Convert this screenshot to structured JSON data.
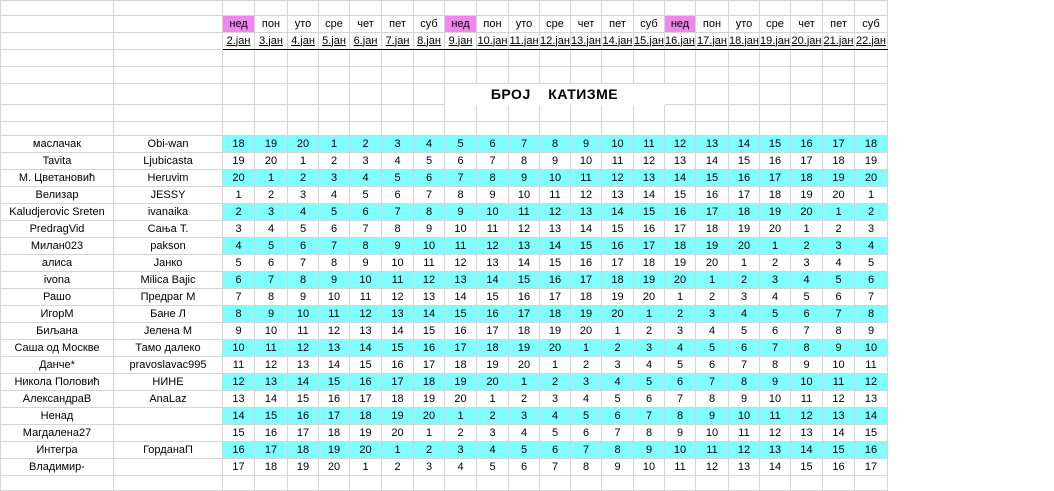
{
  "header": {
    "days": [
      "нед",
      "пон",
      "уто",
      "сре",
      "чет",
      "пет",
      "суб",
      "нед",
      "пон",
      "уто",
      "сре",
      "чет",
      "пет",
      "суб",
      "нед",
      "пон",
      "уто",
      "сре",
      "чет",
      "пет",
      "суб"
    ],
    "dates": [
      "2.јан",
      "3.јан",
      "4.јан",
      "5.јан",
      "6.јан",
      "7.јан",
      "8.јан",
      "9.јан",
      "10.јан",
      "11.јан",
      "12.јан",
      "13.јан",
      "14.јан",
      "15.јан",
      "16.јан",
      "17.јан",
      "18.јан",
      "19.јан",
      "20.јан",
      "21.јан",
      "22.јан"
    ],
    "sunday_color": "#ee88ee"
  },
  "title": "БРОЈ    КАТИЗМЕ",
  "highlight_color": "#7fffff",
  "rows": [
    {
      "name": "маслачак",
      "nick": "Obi-wan",
      "cyan": true,
      "vals": [
        18,
        19,
        20,
        1,
        2,
        3,
        4,
        5,
        6,
        7,
        8,
        9,
        10,
        11,
        12,
        13,
        14,
        15,
        16,
        17,
        18
      ]
    },
    {
      "name": "Tavita",
      "nick": "Ljubicasta",
      "cyan": false,
      "vals": [
        19,
        20,
        1,
        2,
        3,
        4,
        5,
        6,
        7,
        8,
        9,
        10,
        11,
        12,
        13,
        14,
        15,
        16,
        17,
        18,
        19
      ]
    },
    {
      "name": "М. Цветановић",
      "nick": "Heruvim",
      "cyan": true,
      "vals": [
        20,
        1,
        2,
        3,
        4,
        5,
        6,
        7,
        8,
        9,
        10,
        11,
        12,
        13,
        14,
        15,
        16,
        17,
        18,
        19,
        20
      ]
    },
    {
      "name": "Велизар",
      "nick": "JESSY",
      "cyan": false,
      "vals": [
        1,
        2,
        3,
        4,
        5,
        6,
        7,
        8,
        9,
        10,
        11,
        12,
        13,
        14,
        15,
        16,
        17,
        18,
        19,
        20,
        1
      ]
    },
    {
      "name": "Kaludjerovic Sreten",
      "nick": "ivanaika",
      "cyan": true,
      "vals": [
        2,
        3,
        4,
        5,
        6,
        7,
        8,
        9,
        10,
        11,
        12,
        13,
        14,
        15,
        16,
        17,
        18,
        19,
        20,
        1,
        2
      ]
    },
    {
      "name": "PredragVid",
      "nick": "Сања Т.",
      "cyan": false,
      "vals": [
        3,
        4,
        5,
        6,
        7,
        8,
        9,
        10,
        11,
        12,
        13,
        14,
        15,
        16,
        17,
        18,
        19,
        20,
        1,
        2,
        3
      ]
    },
    {
      "name": "Милан023",
      "nick": "pakson",
      "cyan": true,
      "vals": [
        4,
        5,
        6,
        7,
        8,
        9,
        10,
        11,
        12,
        13,
        14,
        15,
        16,
        17,
        18,
        19,
        20,
        1,
        2,
        3,
        4
      ]
    },
    {
      "name": "алиса",
      "nick": "Јанко",
      "cyan": false,
      "vals": [
        5,
        6,
        7,
        8,
        9,
        10,
        11,
        12,
        13,
        14,
        15,
        16,
        17,
        18,
        19,
        20,
        1,
        2,
        3,
        4,
        5
      ]
    },
    {
      "name": "ivona",
      "nick": "Milica Bajic",
      "cyan": true,
      "vals": [
        6,
        7,
        8,
        9,
        10,
        11,
        12,
        13,
        14,
        15,
        16,
        17,
        18,
        19,
        20,
        1,
        2,
        3,
        4,
        5,
        6
      ]
    },
    {
      "name": "Рашо",
      "nick": "Предраг М",
      "cyan": false,
      "vals": [
        7,
        8,
        9,
        10,
        11,
        12,
        13,
        14,
        15,
        16,
        17,
        18,
        19,
        20,
        1,
        2,
        3,
        4,
        5,
        6,
        7
      ]
    },
    {
      "name": "ИгорМ",
      "nick": "Бане Л",
      "cyan": true,
      "vals": [
        8,
        9,
        10,
        11,
        12,
        13,
        14,
        15,
        16,
        17,
        18,
        19,
        20,
        1,
        2,
        3,
        4,
        5,
        6,
        7,
        8
      ]
    },
    {
      "name": "Биљана",
      "nick": "Јелена М",
      "cyan": false,
      "vals": [
        9,
        10,
        11,
        12,
        13,
        14,
        15,
        16,
        17,
        18,
        19,
        20,
        1,
        2,
        3,
        4,
        5,
        6,
        7,
        8,
        9
      ]
    },
    {
      "name": "Саша од Москве",
      "nick": "Тамо далеко",
      "cyan": true,
      "vals": [
        10,
        11,
        12,
        13,
        14,
        15,
        16,
        17,
        18,
        19,
        20,
        1,
        2,
        3,
        4,
        5,
        6,
        7,
        8,
        9,
        10
      ]
    },
    {
      "name": "Данче*",
      "nick": "pravoslavac995",
      "cyan": false,
      "vals": [
        11,
        12,
        13,
        14,
        15,
        16,
        17,
        18,
        19,
        20,
        1,
        2,
        3,
        4,
        5,
        6,
        7,
        8,
        9,
        10,
        11
      ]
    },
    {
      "name": "Никола Половић",
      "nick": "НИНЕ",
      "cyan": true,
      "vals": [
        12,
        13,
        14,
        15,
        16,
        17,
        18,
        19,
        20,
        1,
        2,
        3,
        4,
        5,
        6,
        7,
        8,
        9,
        10,
        11,
        12
      ]
    },
    {
      "name": "АлександраВ",
      "nick": "AnaLaz",
      "cyan": false,
      "vals": [
        13,
        14,
        15,
        16,
        17,
        18,
        19,
        20,
        1,
        2,
        3,
        4,
        5,
        6,
        7,
        8,
        9,
        10,
        11,
        12,
        13
      ]
    },
    {
      "name": "Ненад",
      "nick": "",
      "cyan": true,
      "vals": [
        14,
        15,
        16,
        17,
        18,
        19,
        20,
        1,
        2,
        3,
        4,
        5,
        6,
        7,
        8,
        9,
        10,
        11,
        12,
        13,
        14
      ]
    },
    {
      "name": "Магдалена27",
      "nick": "",
      "cyan": false,
      "vals": [
        15,
        16,
        17,
        18,
        19,
        20,
        1,
        2,
        3,
        4,
        5,
        6,
        7,
        8,
        9,
        10,
        11,
        12,
        13,
        14,
        15
      ]
    },
    {
      "name": "Интегра",
      "nick": "ГорданаП",
      "cyan": true,
      "vals": [
        16,
        17,
        18,
        19,
        20,
        1,
        2,
        3,
        4,
        5,
        6,
        7,
        8,
        9,
        10,
        11,
        12,
        13,
        14,
        15,
        16
      ]
    },
    {
      "name": "Владимир-",
      "nick": "",
      "cyan": false,
      "vals": [
        17,
        18,
        19,
        20,
        1,
        2,
        3,
        4,
        5,
        6,
        7,
        8,
        9,
        10,
        11,
        12,
        13,
        14,
        15,
        16,
        17
      ]
    }
  ]
}
